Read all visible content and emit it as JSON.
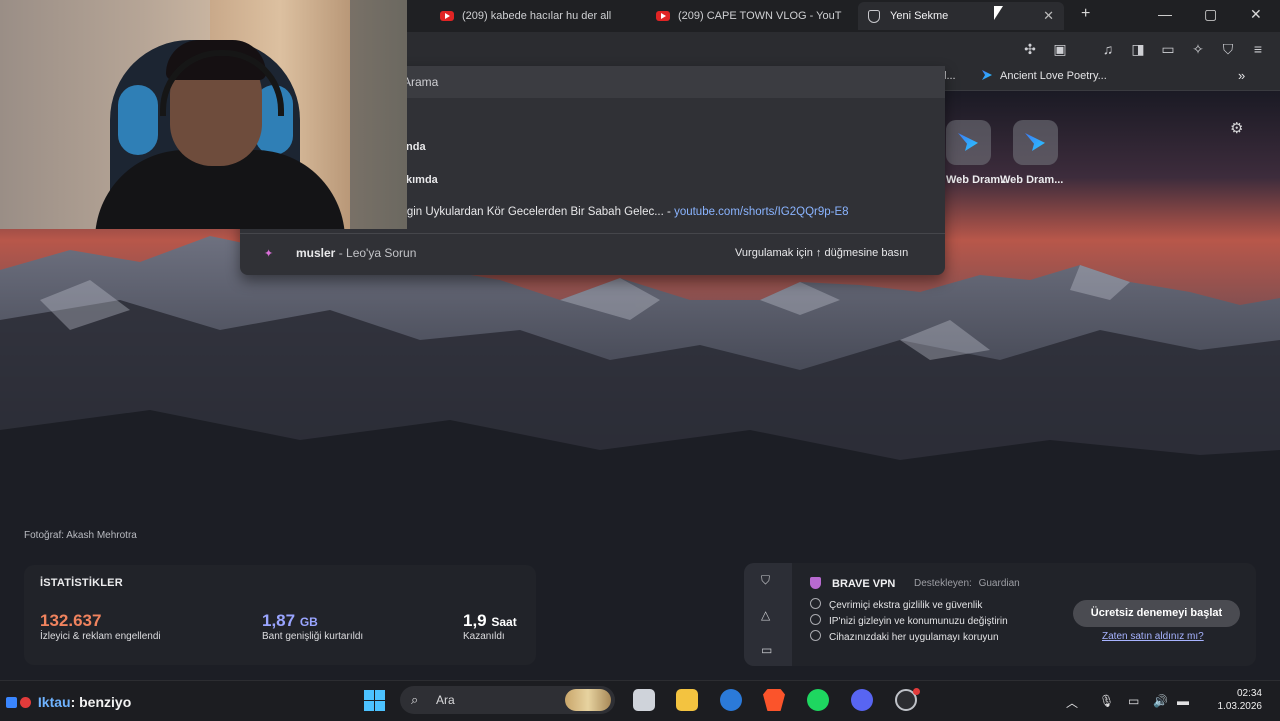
{
  "browser": {
    "tabs": [
      {
        "label": "(209) kabede hacılar hu der all"
      },
      {
        "label": "(209) CAPE TOWN VLOG - YouT"
      },
      {
        "label": "Yeni Sekme",
        "active": true
      }
    ],
    "new_tab": "+",
    "window_controls": {
      "minimize": "—",
      "maximize": "▢",
      "close": "✕"
    }
  },
  "bookmarks": {
    "partial": "l...",
    "items": [
      {
        "label": "Ancient Love Poetry..."
      }
    ],
    "overflow": "»"
  },
  "dropdown": {
    "search_placeholder": "Arama",
    "suggestions": [
      {
        "text": "nda"
      },
      {
        "text": "kımda"
      },
      {
        "text": "rgin Uykulardan Kör Gecelerden Bir Sabah Gelec...",
        "separator": "-",
        "url": "youtube.com/shorts/IG2QQr9p-E8"
      }
    ],
    "leo": {
      "query": "musler",
      "suffix": "- Leo'ya Sorun",
      "hint": "Vurgulamak için ↑ düğmesine basın"
    }
  },
  "top_sites": [
    {
      "label": "Web Dram..."
    },
    {
      "label": "Web Dram..."
    }
  ],
  "photo_credit": "Fotoğraf: Akash Mehrotra",
  "stats": {
    "title": "İSTATİSTİKLER",
    "items": [
      {
        "value": "132.637",
        "unit": "",
        "label": "İzleyici & reklam engellendi",
        "color": "#f0835e"
      },
      {
        "value": "1,87",
        "unit": "GB",
        "label": "Bant genişliği kurtarıldı",
        "color": "#9aa5ff"
      },
      {
        "value": "1,9",
        "unit": "Saat",
        "label": "Kazanıldı",
        "color": "#ffffff"
      }
    ]
  },
  "vpn": {
    "title": "BRAVE VPN",
    "supported_by": "Destekleyen:",
    "partner": "Guardian",
    "features": [
      "Çevrimiçi ekstra gizlilik ve güvenlik",
      "IP'nizi gizleyin ve konumunuzu değiştirin",
      "Cihazınızdaki her uygulamayı koruyun"
    ],
    "cta": "Ücretsiz denemeyi başlat",
    "already_bought": "Zaten satın aldınız mı?"
  },
  "chat_overlay": {
    "username": "Iktau",
    "message": ": benziyo"
  },
  "taskbar": {
    "search_placeholder": "Ara",
    "tray_chevron": "︿",
    "time": "02:34",
    "date": "1.03.2026"
  },
  "colors": {
    "accent": "#8ab4ff",
    "brave": "#fb542b",
    "stats_blocked": "#f0835e",
    "stats_bandwidth": "#9aa5ff"
  }
}
